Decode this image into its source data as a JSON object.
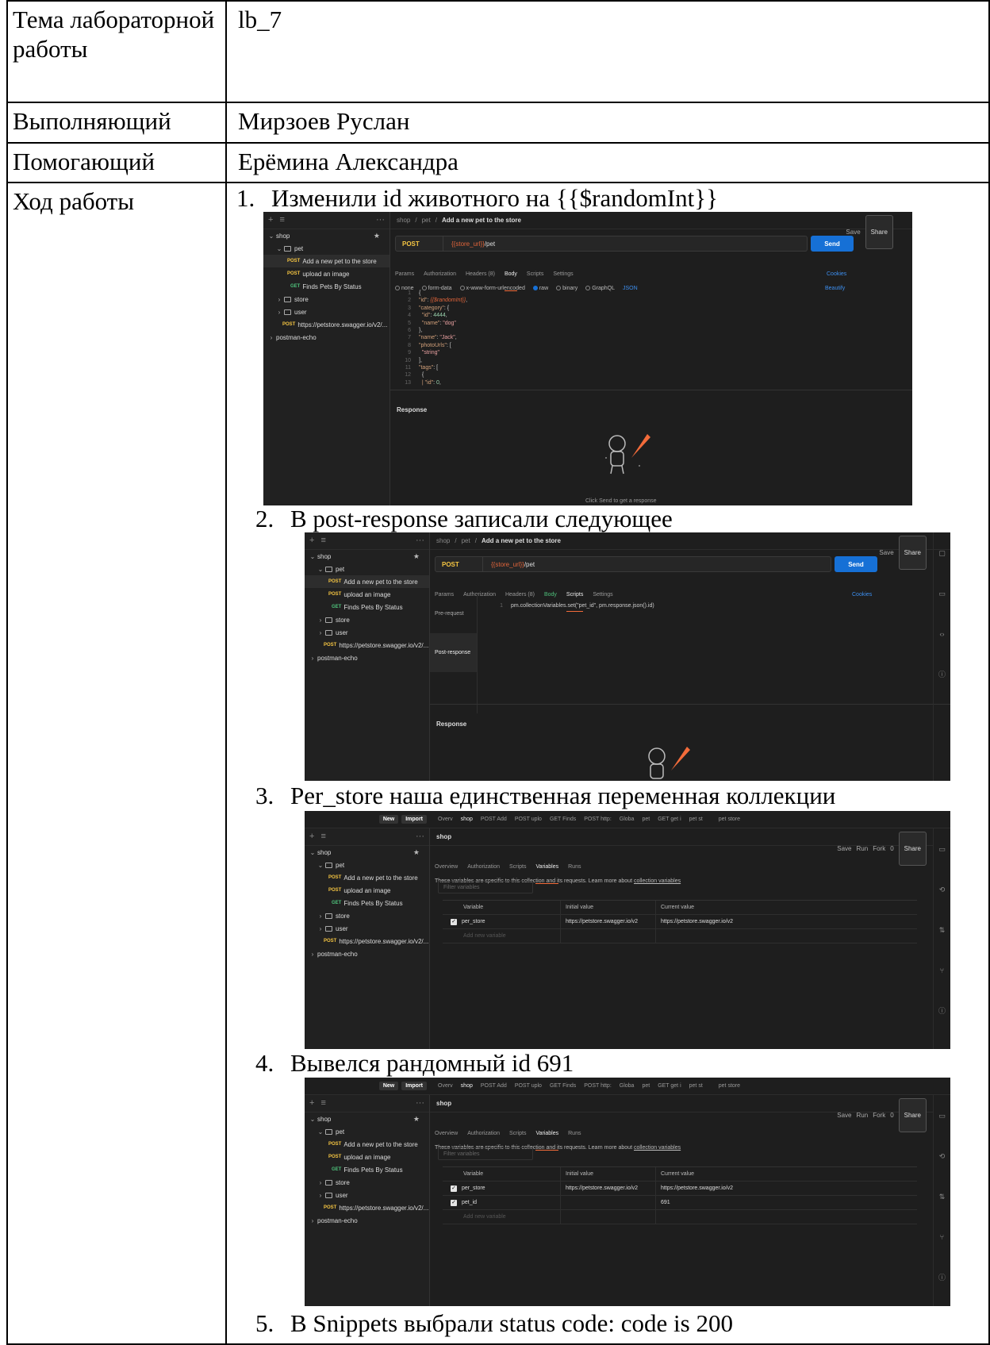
{
  "table": {
    "theme_label": "Тема лабораторной работы",
    "theme_value": "lb_7",
    "executor_label": "Выполняющий",
    "executor_value": "Мирзоев Руслан",
    "helper_label": "Помогающий",
    "helper_value": "Ерёмина Александра",
    "progress_label": "Ход работы"
  },
  "steps": [
    {
      "num": "1.",
      "text": "Изменили id животного на {{$randomInt}}"
    },
    {
      "num": "2.",
      "text": "В post-response записали следующее"
    },
    {
      "num": "3.",
      "text": "Per_store наша единственная переменная коллекции"
    },
    {
      "num": "4.",
      "text": "Вывелся рандомный id 691"
    },
    {
      "num": "5.",
      "text": "В Snippets выбрали status code: code is 200"
    }
  ],
  "postman": {
    "colors": {
      "bg": "#1e1e1e",
      "accent": "#f26b3a",
      "send": "#1670d6",
      "post": "#f5c542",
      "get": "#4ec07a"
    },
    "tree": {
      "shop": "shop",
      "pet": "pet",
      "add_pet": "Add a new pet to the store",
      "upload": "upload an image",
      "finds": "Finds Pets By Status",
      "store": "store",
      "user": "user",
      "url_req": "https://petstore.swagger.io/v2/...",
      "echo": "postman-echo",
      "post": "POST",
      "get": "GET"
    },
    "crumb": {
      "a": "shop",
      "b": "pet",
      "c": "Add a new pet to the store"
    },
    "save": "Save",
    "share": "Share",
    "method": "POST",
    "url_var": "{{store_url}}",
    "url_rest": "/pet",
    "send": "Send",
    "req_tabs": {
      "params": "Params",
      "auth": "Authorization",
      "headers": "Headers (8)",
      "body": "Body",
      "scripts": "Scripts",
      "settings": "Settings",
      "cookies": "Cookies"
    },
    "body_opts": {
      "none": "none",
      "form": "form-data",
      "urlenc": "x-www-form-urlencoded",
      "raw": "raw",
      "binary": "binary",
      "graphql": "GraphQL",
      "json": "JSON",
      "beautify": "Beautify"
    },
    "code_lines": [
      {
        "n": "1",
        "t": "{"
      },
      {
        "n": "2",
        "k": "\"id\"",
        "v": "{{$randomInt}}",
        "tail": ","
      },
      {
        "n": "3",
        "k": "\"category\"",
        "tail": ": {"
      },
      {
        "n": "4",
        "k": "  \"id\"",
        "num": "4444",
        "tail": ","
      },
      {
        "n": "5",
        "k": "  \"name\"",
        "str": "\"dog\""
      },
      {
        "n": "6",
        "t": "},"
      },
      {
        "n": "7",
        "k": "\"name\"",
        "str": "\"Jack\"",
        "tail": ","
      },
      {
        "n": "8",
        "k": "\"photoUrls\"",
        "tail": ": ["
      },
      {
        "n": "9",
        "str": "  \"string\""
      },
      {
        "n": "10",
        "t": "],"
      },
      {
        "n": "11",
        "k": "\"tags\"",
        "tail": ": ["
      },
      {
        "n": "12",
        "t": "  {"
      },
      {
        "n": "13",
        "k": "  | \"id\"",
        "num": "0",
        "tail": ","
      }
    ],
    "response": "Response",
    "click_send": "Click Send to get a response",
    "script_sections": {
      "pre": "Pre-request",
      "post": "Post-response"
    },
    "script_line": "pm.collectionVariables.set(\"pet_id\", pm.response.json().id)",
    "script_line_num": "1",
    "topbar": {
      "new": "New",
      "import": "Import",
      "tabs": [
        "Overv",
        "shop",
        "POST Add",
        "POST uplo",
        "GET Finds",
        "POST http:",
        "Globa",
        "pet",
        "GET get i",
        "pet st"
      ],
      "env": "pet store"
    },
    "coll": {
      "title": "shop",
      "tabs": {
        "overview": "Overview",
        "auth": "Authorization",
        "scripts": "Scripts",
        "variables": "Variables",
        "runs": "Runs"
      },
      "run": "Run",
      "fork": "Fork",
      "fork_count": "0",
      "desc": "These variables are specific to this collection and its requests. Learn more about",
      "desc_link": "collection variables",
      "filter": "Filter variables",
      "cols": {
        "variable": "Variable",
        "initial": "Initial value",
        "current": "Current value"
      },
      "rows3": [
        {
          "name": "per_store",
          "initial": "https://petstore.swagger.io/v2",
          "current": "https://petstore.swagger.io/v2"
        }
      ],
      "rows4": [
        {
          "name": "per_store",
          "initial": "https://petstore.swagger.io/v2",
          "current": "https://petstore.swagger.io/v2"
        },
        {
          "name": "pet_id",
          "initial": "",
          "current": "691"
        }
      ],
      "add_new": "Add new variable"
    }
  }
}
